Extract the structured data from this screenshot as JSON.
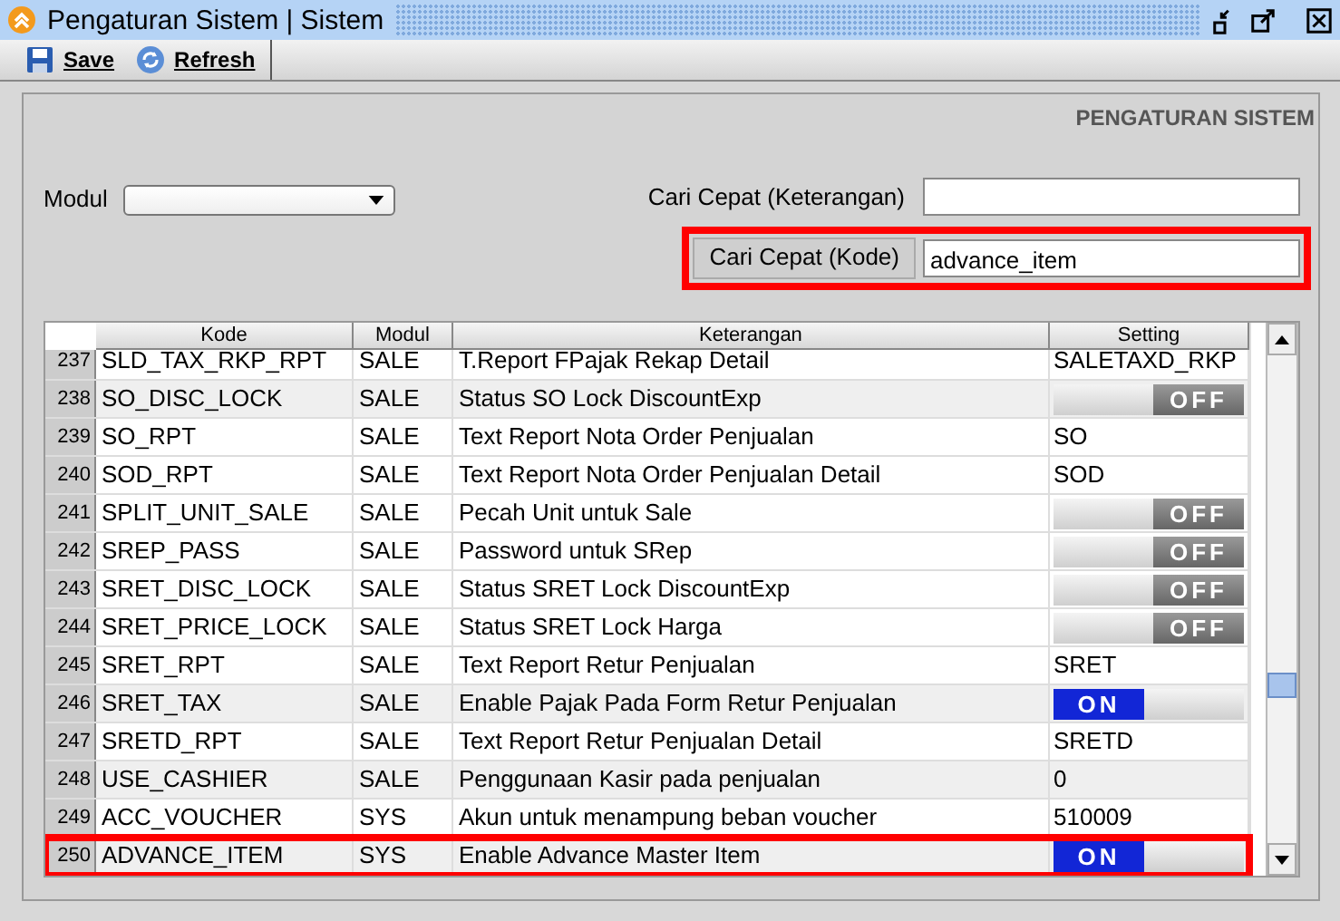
{
  "window": {
    "title": "Pengaturan Sistem | Sistem"
  },
  "toolbar": [
    {
      "label": "Save",
      "kind": "save"
    },
    {
      "label": "Refresh",
      "kind": "refresh"
    }
  ],
  "section_title": "PENGATURAN SISTEM",
  "filters": {
    "modul": {
      "label": "Modul"
    },
    "search_description": {
      "label": "Cari Cepat (Keterangan)"
    },
    "search_code": {
      "label": "Cari Cepat (Kode)",
      "value": "advance_item",
      "highlighted": true
    }
  },
  "table": {
    "columns": [
      "Kode",
      "Modul",
      "Keterangan",
      "Setting"
    ],
    "rows": [
      {
        "number": "237",
        "kode": "SLD_TAX_RKP_RPT",
        "modul": "SALE",
        "keterangan": "T.Report FPajak Rekap Detail",
        "setting": {
          "kind": "text",
          "value": "SALETAXD_RKP"
        },
        "shaded": false,
        "highlighted": false
      },
      {
        "number": "238",
        "kode": "SO_DISC_LOCK",
        "modul": "SALE",
        "keterangan": "Status SO Lock DiscountExp",
        "setting": {
          "kind": "toggle",
          "on": false,
          "label": "OFF"
        },
        "shaded": true,
        "highlighted": false
      },
      {
        "number": "239",
        "kode": "SO_RPT",
        "modul": "SALE",
        "keterangan": "Text Report Nota Order Penjualan",
        "setting": {
          "kind": "text",
          "value": "SO"
        },
        "shaded": false,
        "highlighted": false
      },
      {
        "number": "240",
        "kode": "SOD_RPT",
        "modul": "SALE",
        "keterangan": "Text Report Nota Order Penjualan Detail",
        "setting": {
          "kind": "text",
          "value": "SOD"
        },
        "shaded": false,
        "highlighted": false
      },
      {
        "number": "241",
        "kode": "SPLIT_UNIT_SALE",
        "modul": "SALE",
        "keterangan": "Pecah Unit untuk Sale",
        "setting": {
          "kind": "toggle",
          "on": false,
          "label": "OFF"
        },
        "shaded": false,
        "highlighted": false
      },
      {
        "number": "242",
        "kode": "SREP_PASS",
        "modul": "SALE",
        "keterangan": "Password untuk SRep",
        "setting": {
          "kind": "toggle",
          "on": false,
          "label": "OFF"
        },
        "shaded": false,
        "highlighted": false
      },
      {
        "number": "243",
        "kode": "SRET_DISC_LOCK",
        "modul": "SALE",
        "keterangan": "Status SRET Lock DiscountExp",
        "setting": {
          "kind": "toggle",
          "on": false,
          "label": "OFF"
        },
        "shaded": false,
        "highlighted": false
      },
      {
        "number": "244",
        "kode": "SRET_PRICE_LOCK",
        "modul": "SALE",
        "keterangan": "Status SRET Lock Harga",
        "setting": {
          "kind": "toggle",
          "on": false,
          "label": "OFF"
        },
        "shaded": false,
        "highlighted": false
      },
      {
        "number": "245",
        "kode": "SRET_RPT",
        "modul": "SALE",
        "keterangan": "Text Report Retur Penjualan",
        "setting": {
          "kind": "text",
          "value": "SRET"
        },
        "shaded": false,
        "highlighted": false
      },
      {
        "number": "246",
        "kode": "SRET_TAX",
        "modul": "SALE",
        "keterangan": "Enable Pajak Pada Form Retur Penjualan",
        "setting": {
          "kind": "toggle",
          "on": true,
          "label": "ON"
        },
        "shaded": true,
        "highlighted": false
      },
      {
        "number": "247",
        "kode": "SRETD_RPT",
        "modul": "SALE",
        "keterangan": "Text Report Retur Penjualan Detail",
        "setting": {
          "kind": "text",
          "value": "SRETD"
        },
        "shaded": false,
        "highlighted": false
      },
      {
        "number": "248",
        "kode": "USE_CASHIER",
        "modul": "SALE",
        "keterangan": "Penggunaan Kasir pada penjualan",
        "setting": {
          "kind": "text",
          "value": "0"
        },
        "shaded": true,
        "highlighted": false
      },
      {
        "number": "249",
        "kode": "ACC_VOUCHER",
        "modul": "SYS",
        "keterangan": "Akun untuk menampung beban voucher",
        "setting": {
          "kind": "text",
          "value": "510009"
        },
        "shaded": false,
        "highlighted": false
      },
      {
        "number": "250",
        "kode": "ADVANCE_ITEM",
        "modul": "SYS",
        "keterangan": "Enable Advance Master Item",
        "setting": {
          "kind": "toggle",
          "on": true,
          "label": "ON"
        },
        "shaded": true,
        "highlighted": true
      }
    ]
  }
}
